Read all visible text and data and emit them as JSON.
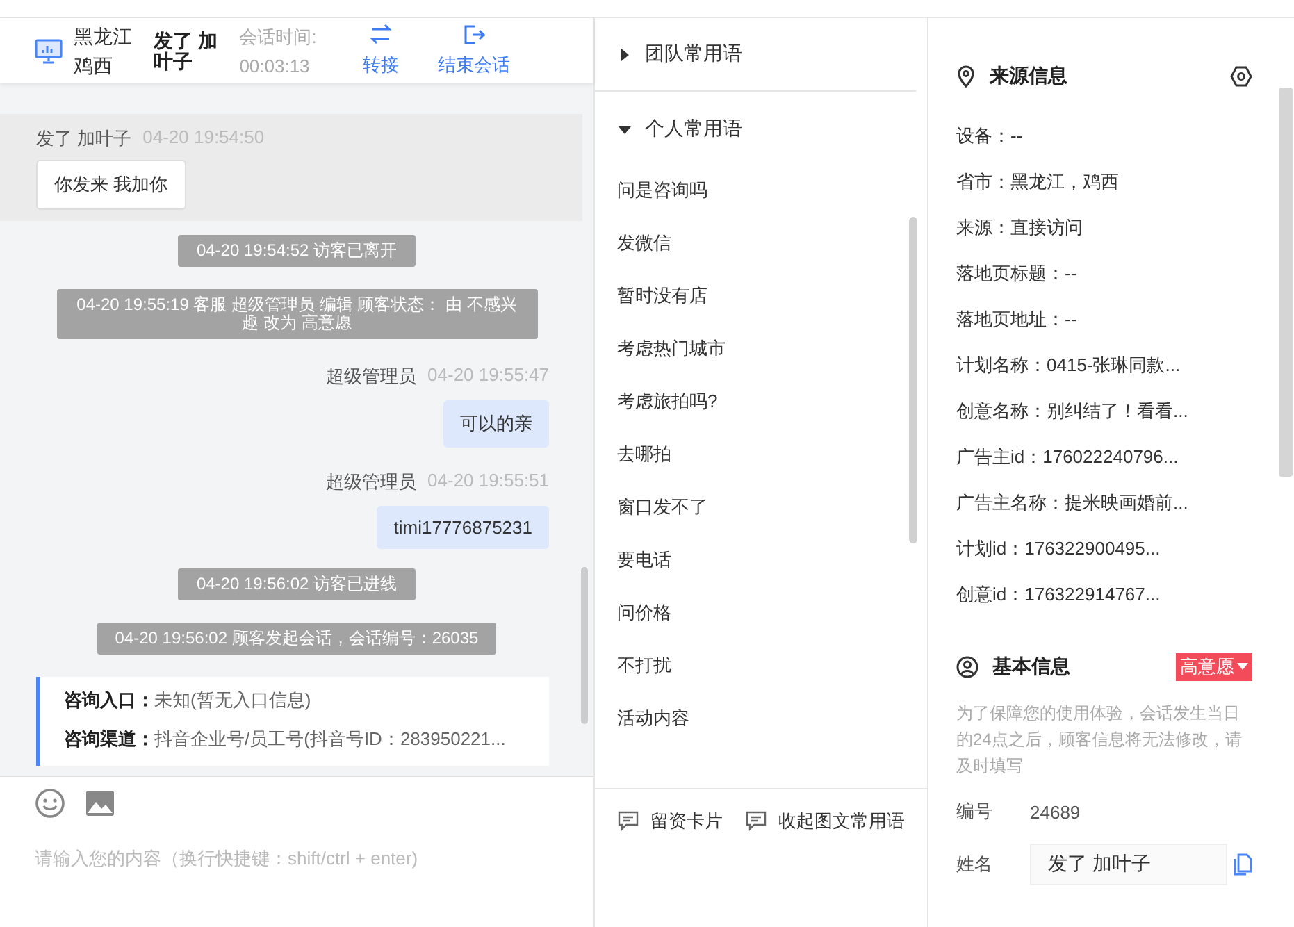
{
  "header": {
    "location": "黑龙江鸡西",
    "visitor_name": "发了 加叶子",
    "session_time_label": "会话时间:",
    "session_time": "00:03:13",
    "actions": [
      {
        "kind": "transfer",
        "label": "转接"
      },
      {
        "kind": "end",
        "label": "结束会话"
      }
    ]
  },
  "chat": {
    "messages": [
      {
        "kind": "visitor",
        "highlighted": true,
        "sender": "发了 加叶子",
        "time": "04-20 19:54:50",
        "text": "你发来 我加你"
      },
      {
        "kind": "system",
        "text": "04-20 19:54:52 访客已离开"
      },
      {
        "kind": "system",
        "text": "04-20 19:55:19 客服 超级管理员 编辑 顾客状态： 由 不感兴趣 改为 高意愿"
      },
      {
        "kind": "agent",
        "sender": "超级管理员",
        "time": "04-20 19:55:47",
        "text": "可以的亲"
      },
      {
        "kind": "agent",
        "sender": "超级管理员",
        "time": "04-20 19:55:51",
        "text": "timi17776875231"
      },
      {
        "kind": "system",
        "text": "04-20 19:56:02 访客已进线"
      },
      {
        "kind": "system",
        "text": "04-20 19:56:02 顾客发起会话，会话编号：26035"
      },
      {
        "kind": "info_card",
        "lines": [
          {
            "label": "咨询入口：",
            "value": "未知(暂无入口信息)"
          },
          {
            "label": "咨询渠道：",
            "value": "抖音企业号/员工号(抖音号ID：283950221..."
          }
        ]
      }
    ],
    "input": {
      "placeholder": "请输入您的内容（换行快捷键：shift/ctrl + enter)"
    }
  },
  "phrases": {
    "groups": [
      {
        "label": "团队常用语",
        "expanded": false
      },
      {
        "label": "个人常用语",
        "expanded": true,
        "items": [
          "问是咨询吗",
          "发微信",
          "暂时没有店",
          "考虑热门城市",
          "考虑旅拍吗?",
          "去哪拍",
          "窗口发不了",
          "要电话",
          "问价格",
          "不打扰",
          "活动内容"
        ]
      }
    ],
    "footer_buttons": [
      "留资卡片",
      "收起图文常用语"
    ]
  },
  "source_info": {
    "title": "来源信息",
    "rows": [
      "设备：--",
      "省市：黑龙江，鸡西",
      "来源：直接访问",
      "落地页标题：--",
      "落地页地址：--",
      "计划名称：0415-张琳同款...",
      "创意名称：别纠结了！看看...",
      "广告主id：176022240796...",
      "广告主名称：提米映画婚前...",
      "计划id：176322900495...",
      "创意id：176322914767..."
    ]
  },
  "basic_info": {
    "title": "基本信息",
    "status": "高意愿",
    "notice": "为了保障您的使用体验，会话发生当日的24点之后，顾客信息将无法修改，请及时填写",
    "fields": [
      {
        "kind": "text",
        "label": "编号",
        "value": "24689"
      },
      {
        "kind": "input",
        "label": "姓名",
        "value": "发了 加叶子"
      }
    ]
  }
}
